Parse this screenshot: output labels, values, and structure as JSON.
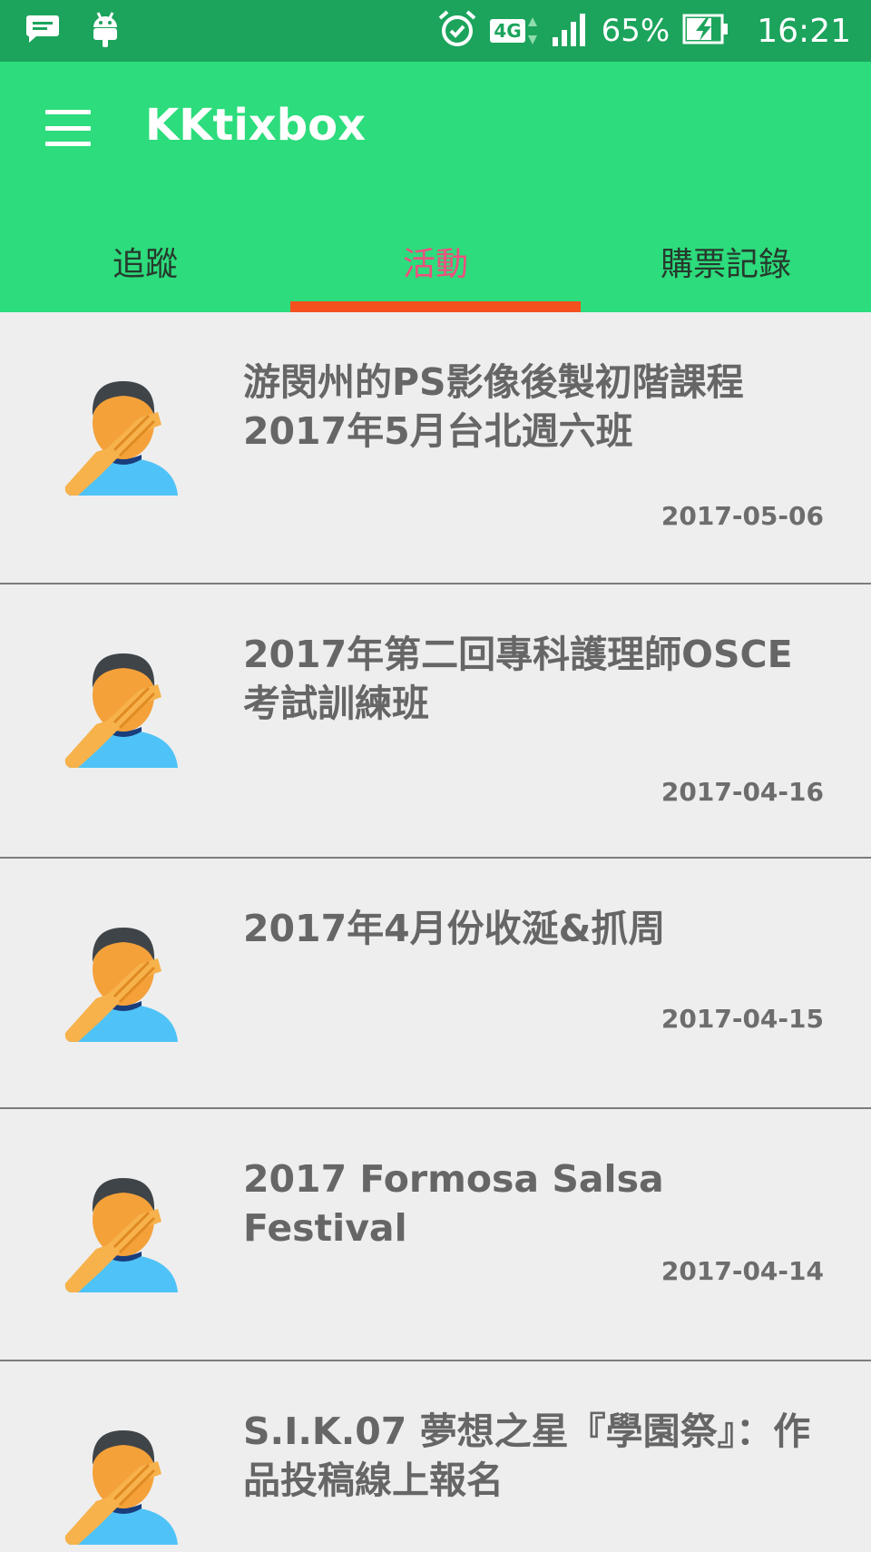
{
  "status_bar": {
    "left_icons": [
      "chat-icon",
      "android-icon"
    ],
    "right_icons": [
      "alarm-icon",
      "lte-4g-icon",
      "signal-icon",
      "battery-charging-icon"
    ],
    "network": "4G",
    "battery": "65%",
    "time": "16:21"
  },
  "app_bar": {
    "title": "KKtixbox",
    "menu_icon": "hamburger-menu-icon",
    "color": "#2ddc7c"
  },
  "tabs": [
    {
      "label": "追蹤",
      "active": false
    },
    {
      "label": "活動",
      "active": true
    },
    {
      "label": "購票記錄",
      "active": false
    }
  ],
  "accent_color": "#f4511e",
  "events": [
    {
      "title": "游閔州的PS影像後製初階課程2017年5月台北週六班",
      "date": "2017-05-06",
      "avatar_icon": "facepalm-person-icon"
    },
    {
      "title": "2017年第二回專科護理師OSCE考試訓練班",
      "date": "2017-04-16",
      "avatar_icon": "facepalm-person-icon"
    },
    {
      "title": "2017年4月份收涎&抓周",
      "date": "2017-04-15",
      "avatar_icon": "facepalm-person-icon"
    },
    {
      "title": "2017 Formosa Salsa Festival",
      "date": "2017-04-14",
      "avatar_icon": "facepalm-person-icon"
    },
    {
      "title": "S.I.K.07 夢想之星『學園祭』：作品投稿線上報名",
      "date": "",
      "avatar_icon": "facepalm-person-icon"
    }
  ]
}
